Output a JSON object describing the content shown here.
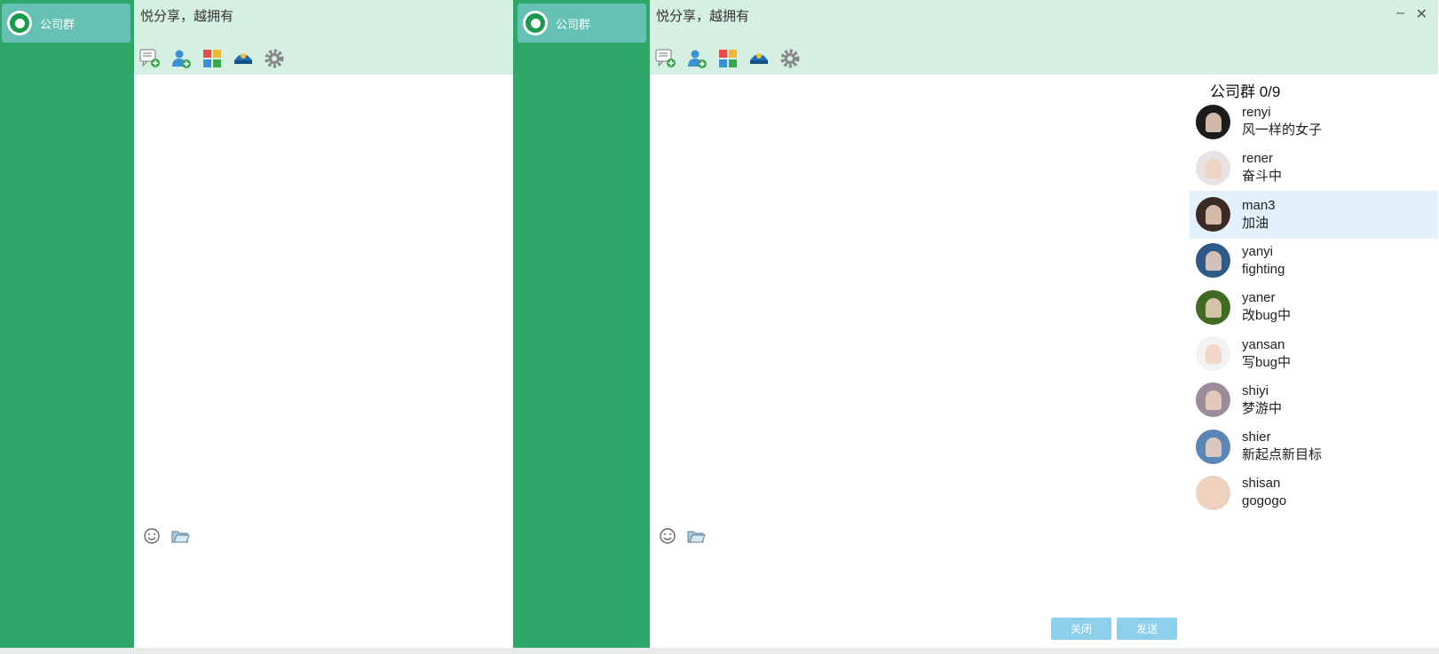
{
  "left_window": {
    "group_name": "公司群",
    "title": "悦分享，越拥有"
  },
  "right_window": {
    "group_name": "公司群",
    "title": "悦分享，越拥有",
    "minimize_label": "–",
    "close_label": "✕",
    "members_title": "公司群 0/9",
    "members": [
      {
        "name": "renyi",
        "status": "风一样的女子",
        "avatar_color": "#1c1c1c"
      },
      {
        "name": "rener",
        "status": "奋斗中",
        "avatar_color": "#e8e2e2"
      },
      {
        "name": "man3",
        "status": "加油",
        "avatar_color": "#3a2b26"
      },
      {
        "name": "yanyi",
        "status": "fighting",
        "avatar_color": "#2e5a8a"
      },
      {
        "name": "yaner",
        "status": "改bug中",
        "avatar_color": "#3f6b22"
      },
      {
        "name": "yansan",
        "status": "写bug中",
        "avatar_color": "#f2f2f2"
      },
      {
        "name": "shiyi",
        "status": "梦游中",
        "avatar_color": "#9c8c9a"
      },
      {
        "name": "shier",
        "status": "新起点新目标",
        "avatar_color": "#5b86b8"
      },
      {
        "name": "shisan",
        "status": "gogogo",
        "avatar_color": "#eed2c0"
      }
    ],
    "selected_member": "man3",
    "close_button": "关闭",
    "send_button": "发送"
  },
  "colors": {
    "sidebar": "#2fa769",
    "group_item": "#66c0b4",
    "header": "#d6efe3",
    "button": "#8dd0eb",
    "selected_row": "#e2f1fb"
  },
  "icons": [
    "new-chat-icon",
    "add-user-icon",
    "apps-icon",
    "captain-hat-icon",
    "gear-icon",
    "emoji-icon",
    "folder-icon"
  ]
}
